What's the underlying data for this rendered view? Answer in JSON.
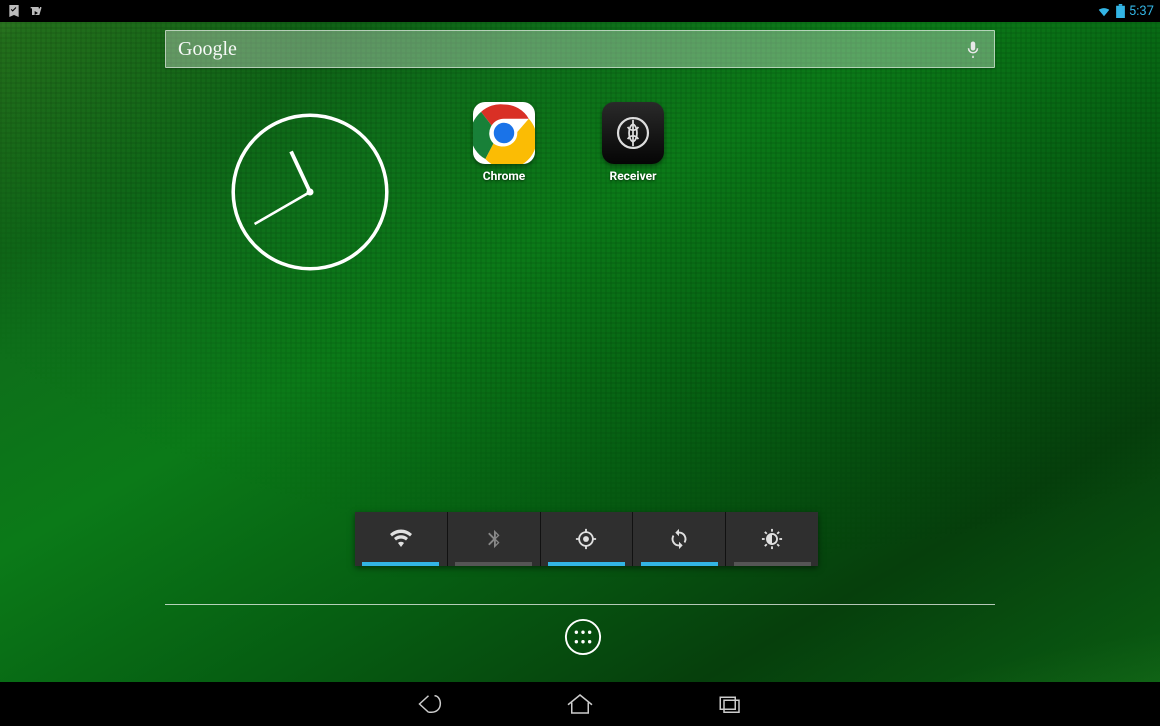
{
  "statusbar": {
    "notif_left": [
      "download-done-icon",
      "play-store-icon"
    ],
    "wifi_strength": 3,
    "battery_level_pct": 95,
    "clock_text": "5:37"
  },
  "search": {
    "placeholder": "Google",
    "voice_icon": "microphone-icon"
  },
  "clock_widget": {
    "hour_hand_deg": 335,
    "minute_hand_deg": 240
  },
  "apps": [
    {
      "id": "chrome",
      "label": "Chrome",
      "icon": "chrome-icon"
    },
    {
      "id": "receiver",
      "label": "Receiver",
      "icon": "citrix-receiver-icon"
    }
  ],
  "power_toggles": [
    {
      "id": "wifi",
      "icon": "wifi-icon",
      "enabled": true
    },
    {
      "id": "bluetooth",
      "icon": "bluetooth-icon",
      "enabled": false
    },
    {
      "id": "gps",
      "icon": "gps-icon",
      "enabled": true
    },
    {
      "id": "sync",
      "icon": "sync-icon",
      "enabled": true
    },
    {
      "id": "brightness",
      "icon": "brightness-icon",
      "enabled": false
    }
  ],
  "dock": {
    "app_drawer_icon": "app-drawer-icon"
  },
  "navbar": {
    "back_icon": "back-icon",
    "home_icon": "home-icon",
    "recents_icon": "recents-icon"
  }
}
